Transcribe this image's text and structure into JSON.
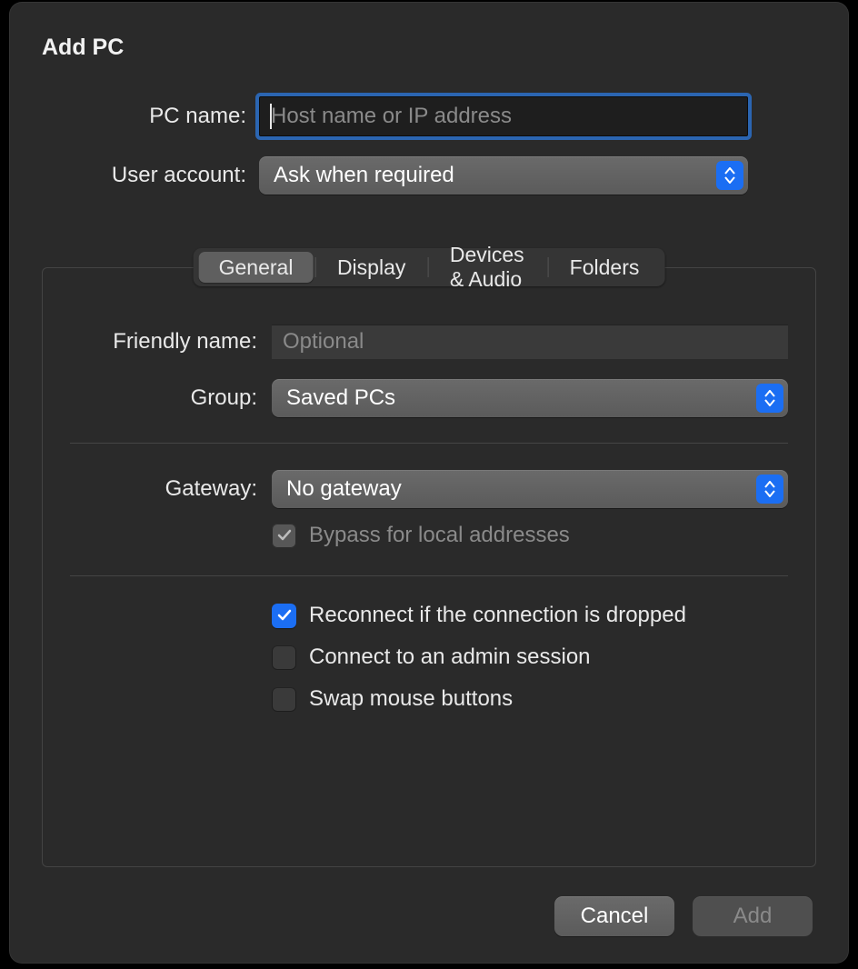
{
  "title": "Add PC",
  "fields": {
    "pc_name": {
      "label": "PC name:",
      "value": "",
      "placeholder": "Host name or IP address"
    },
    "user_account": {
      "label": "User account:",
      "value": "Ask when required"
    }
  },
  "tabs": {
    "items": [
      "General",
      "Display",
      "Devices & Audio",
      "Folders"
    ],
    "active_index": 0
  },
  "general": {
    "friendly_name": {
      "label": "Friendly name:",
      "value": "",
      "placeholder": "Optional"
    },
    "group": {
      "label": "Group:",
      "value": "Saved PCs"
    },
    "gateway": {
      "label": "Gateway:",
      "value": "No gateway"
    },
    "bypass": {
      "label": "Bypass for local addresses",
      "checked": true,
      "disabled": true
    },
    "reconnect": {
      "label": "Reconnect if the connection is dropped",
      "checked": true
    },
    "admin_session": {
      "label": "Connect to an admin session",
      "checked": false
    },
    "swap_mouse": {
      "label": "Swap mouse buttons",
      "checked": false
    }
  },
  "footer": {
    "cancel": "Cancel",
    "add": "Add"
  }
}
